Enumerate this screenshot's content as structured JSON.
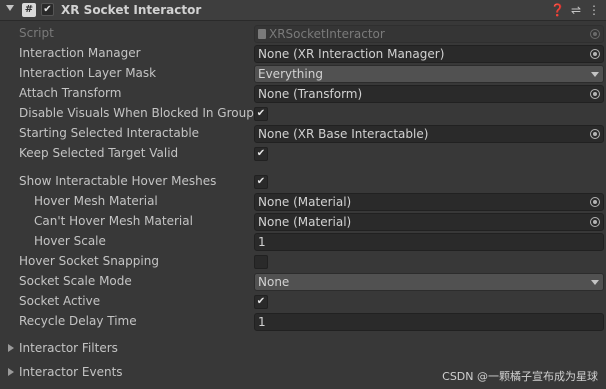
{
  "header": {
    "title": "XR Socket Interactor",
    "enabled": "✔",
    "script_icon": "#"
  },
  "fields": [
    {
      "label": "Script",
      "value": "XRSocketInteractor",
      "kind": "object",
      "dim": true,
      "file_icon": true
    },
    {
      "label": "Interaction Manager",
      "value": "None (XR Interaction Manager)",
      "kind": "object"
    },
    {
      "label": "Interaction Layer Mask",
      "value": "Everything",
      "kind": "dropdown"
    },
    {
      "label": "Attach Transform",
      "value": "None (Transform)",
      "kind": "object"
    },
    {
      "label": "Disable Visuals When Blocked In Group",
      "value": "✔",
      "kind": "toggle"
    },
    {
      "label": "Starting Selected Interactable",
      "value": "None (XR Base Interactable)",
      "kind": "object"
    },
    {
      "label": "Keep Selected Target Valid",
      "value": "✔",
      "kind": "toggle"
    },
    {
      "label": "Show Interactable Hover Meshes",
      "value": "✔",
      "kind": "toggle"
    },
    {
      "label": "Hover Mesh Material",
      "value": "None (Material)",
      "kind": "object",
      "indent": true
    },
    {
      "label": "Can't Hover Mesh Material",
      "value": "None (Material)",
      "kind": "object",
      "indent": true
    },
    {
      "label": "Hover Scale",
      "value": "1",
      "kind": "number",
      "indent": true
    },
    {
      "label": "Hover Socket Snapping",
      "value": "",
      "kind": "toggle"
    },
    {
      "label": "Socket Scale Mode",
      "value": "None",
      "kind": "dropdown"
    },
    {
      "label": "Socket Active",
      "value": "✔",
      "kind": "toggle"
    },
    {
      "label": "Recycle Delay Time",
      "value": "1",
      "kind": "number"
    }
  ],
  "foldouts": [
    {
      "label": "Interactor Filters"
    },
    {
      "label": "Interactor Events"
    }
  ],
  "watermark": "CSDN @一颗橘子宣布成为星球",
  "colors": {
    "background": "#383838",
    "header": "#3e3e3e",
    "field": "#2a2a2a",
    "dropdown": "#515151",
    "text": "#c4c4c4"
  }
}
